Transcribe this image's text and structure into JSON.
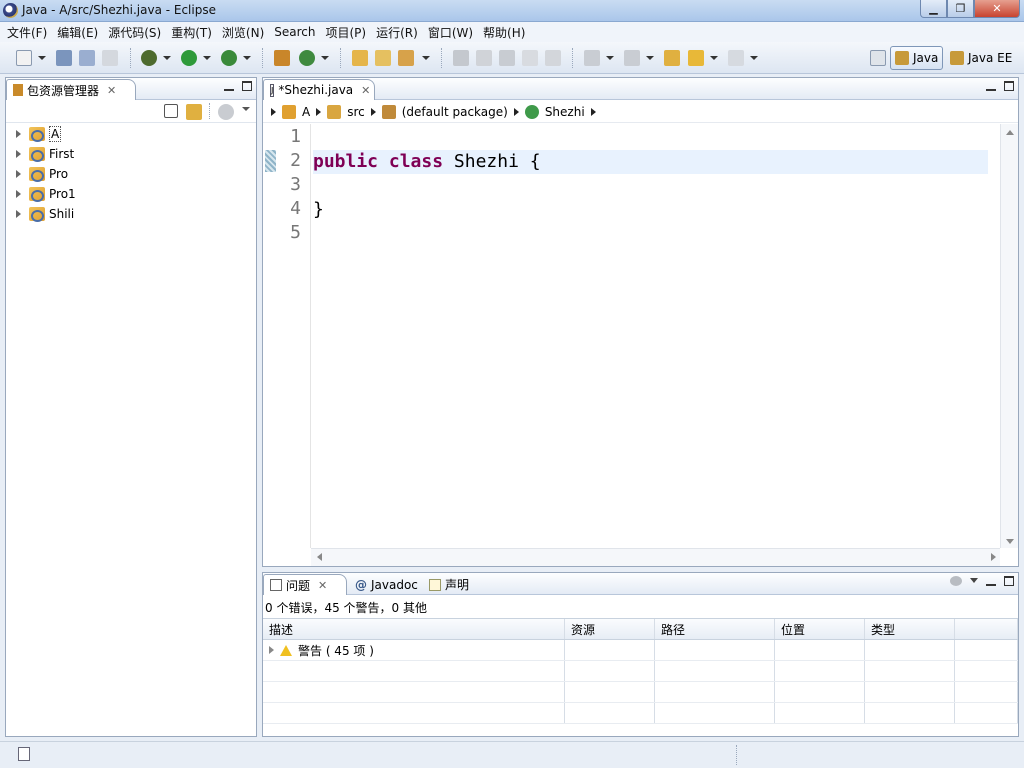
{
  "window": {
    "title": "Java  -  A/src/Shezhi.java  -  Eclipse",
    "minimize_label": "▁",
    "maximize_label": "❐",
    "close_label": "✕"
  },
  "menu": [
    "文件(F)",
    "编辑(E)",
    "源代码(S)",
    "重构(T)",
    "浏览(N)",
    "Search",
    "项目(P)",
    "运行(R)",
    "窗口(W)",
    "帮助(H)"
  ],
  "perspectives": {
    "java": "Java",
    "javaee": "Java EE"
  },
  "package_explorer": {
    "title": "包资源管理器",
    "projects": [
      "A",
      "First",
      "Pro",
      "Pro1",
      "Shili"
    ]
  },
  "editor": {
    "tab_label": "*Shezhi.java",
    "breadcrumb": [
      "A",
      "src",
      "(default package)",
      "Shezhi"
    ],
    "line_numbers": [
      "1",
      "2",
      "3",
      "4",
      "5"
    ],
    "code": {
      "line2_kw1": "public",
      "line2_kw2": "class",
      "line2_rest": " Shezhi {",
      "line4": "}"
    }
  },
  "problems": {
    "tabs": [
      "问题",
      "Javadoc",
      "声明"
    ],
    "summary": "0 个错误，45 个警告，0 其他",
    "columns": [
      "描述",
      "资源",
      "路径",
      "位置",
      "类型"
    ],
    "rows": [
      {
        "description": "警告 ( 45 项 )"
      }
    ]
  },
  "colors": {
    "keyword": "#7f0055",
    "current_line": "#e8f2fe",
    "accent": "#aac6ea"
  },
  "icons": [
    "eclipse-app-icon",
    "new-icon",
    "save-icon",
    "debug-icon",
    "run-icon",
    "package-icon",
    "project-icon",
    "warning-icon",
    "class-icon"
  ]
}
